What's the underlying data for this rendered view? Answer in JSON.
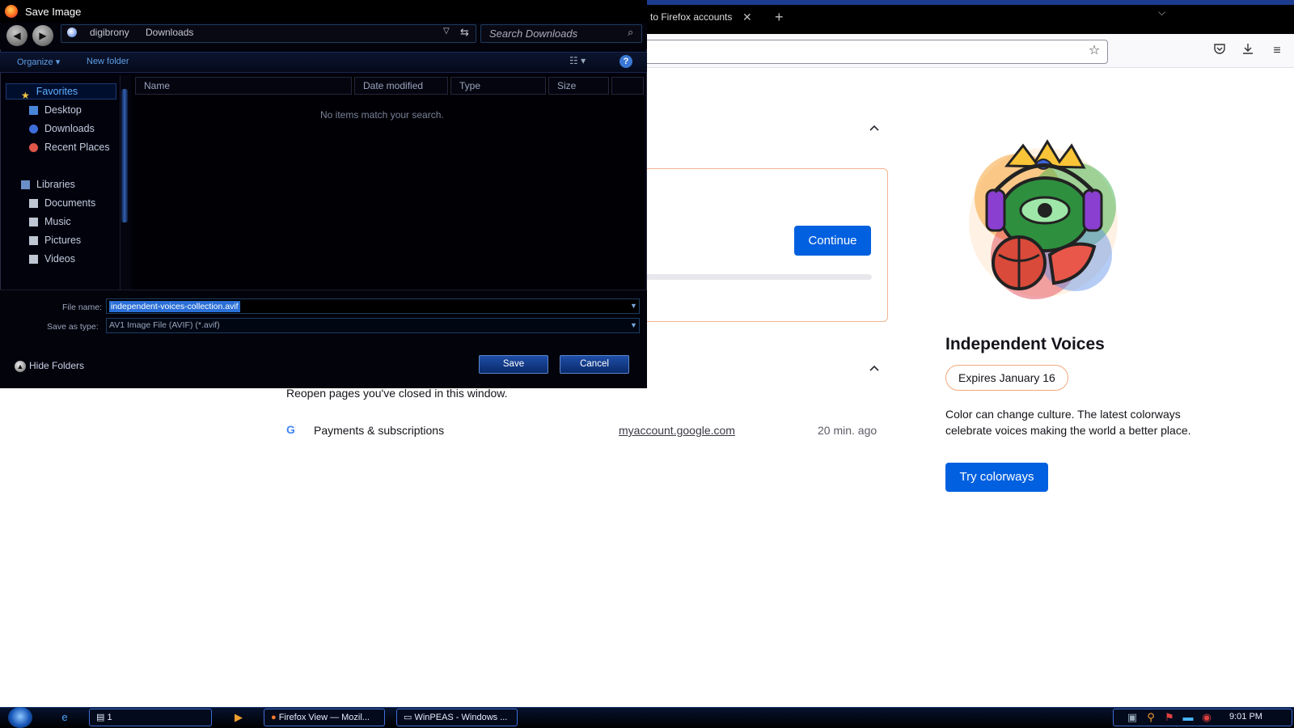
{
  "firefox": {
    "tab_title": "to Firefox accounts",
    "tab_close": "✕",
    "new_tab": "+",
    "tablist": "⌵",
    "icons": {
      "bookmark": "star-icon",
      "pocket": "pocket-icon",
      "downloads": "download-icon",
      "menu": "hamburger-menu-icon"
    },
    "continue_label": "Continue",
    "recently_closed_desc": "Reopen pages you've closed in this window.",
    "recent_item": {
      "icon": "G",
      "title": "Payments & subscriptions",
      "url": "myaccount.google.com",
      "time": "20 min. ago"
    },
    "colorway": {
      "title": "Independent Voices",
      "expires": "Expires January 16",
      "description": "Color can change culture. The latest colorways celebrate voices making the world a better place.",
      "button": "Try colorways"
    },
    "accent_color": "#0060df"
  },
  "dialog": {
    "title": "Save Image",
    "breadcrumb": [
      "digibrony",
      "Downloads"
    ],
    "search_placeholder": "Search Downloads",
    "toolbar": {
      "organize": "Organize ▾",
      "new_folder": "New folder",
      "help": "?"
    },
    "nav": {
      "favorites": "Favorites",
      "desktop": "Desktop",
      "downloads": "Downloads",
      "recent_places": "Recent Places",
      "libraries": "Libraries",
      "documents": "Documents",
      "music": "Music",
      "pictures": "Pictures",
      "videos": "Videos"
    },
    "columns": [
      "Name",
      "Date modified",
      "Type",
      "Size"
    ],
    "empty_message": "No items match your search.",
    "file_name_label": "File name:",
    "file_name_value": "independent-voices-collection.avif",
    "save_type_label": "Save as type:",
    "save_type_value": "AV1 Image File (AVIF) (*.avif)",
    "hide_folders": "Hide Folders",
    "save_button": "Save",
    "cancel_button": "Cancel"
  },
  "taskbar": {
    "item1": "1",
    "firefox": "Firefox View — Mozil...",
    "winpeas": "WinPEAS - Windows ...",
    "clock": "9:01 PM"
  }
}
